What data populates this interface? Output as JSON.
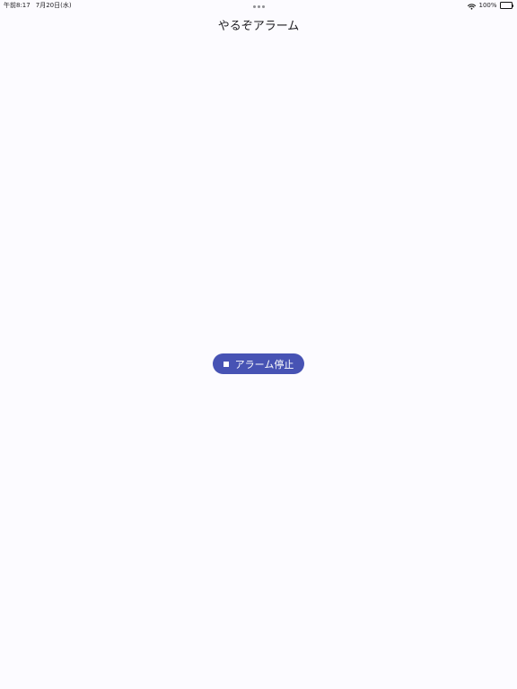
{
  "status_bar": {
    "time": "午前8:17",
    "date": "7月20日(水)",
    "battery": "100%",
    "wifi_icon": "wifi-icon",
    "battery_icon": "battery-full-icon"
  },
  "app_bar": {
    "title": "やるぞアラーム"
  },
  "main": {
    "stop_button": {
      "label": "アラーム停止",
      "icon": "stop-icon",
      "background": "#4753b4",
      "text_color": "#ffffff"
    }
  },
  "colors": {
    "page_background": "#fcfbff",
    "text": "#1c1b1f"
  }
}
